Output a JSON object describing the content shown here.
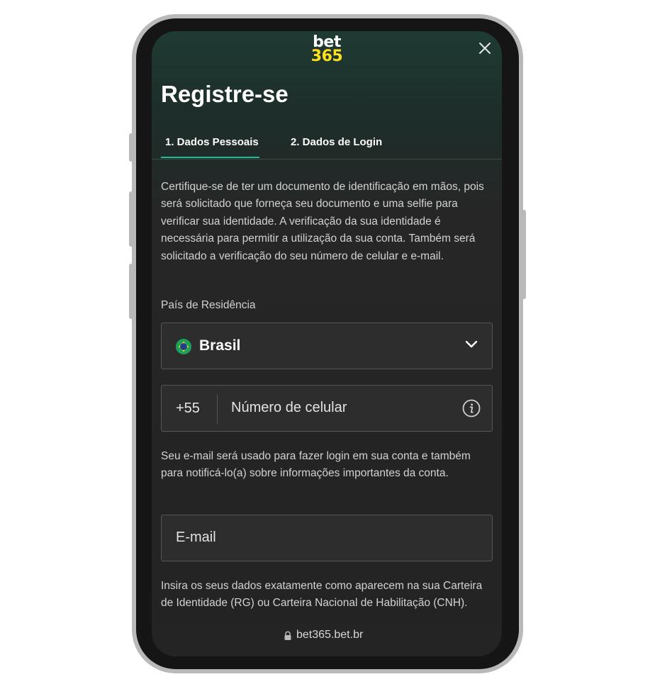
{
  "brand": {
    "logo_top": "bet",
    "logo_bottom": "365"
  },
  "page": {
    "title": "Registre-se"
  },
  "tabs": [
    {
      "label": "1. Dados Pessoais",
      "active": true
    },
    {
      "label": "2. Dados de Login",
      "active": false
    }
  ],
  "intro_text": "Certifique-se de ter um documento de identificação em mãos, pois será solicitado que forneça seu documento e uma selfie para verificar sua identidade. A verificação da sua identidade é necessária para permitir a utilização da sua conta. Também será solicitado a verificação do seu número de celular e e-mail.",
  "country": {
    "label": "País de Residência",
    "value": "Brasil",
    "flag_icon": "brazil-flag-icon"
  },
  "phone": {
    "country_code": "+55",
    "placeholder": "Número de celular"
  },
  "email_note": "Seu e-mail será usado para fazer login em sua conta e também para notificá-lo(a) sobre informações importantes da conta.",
  "email": {
    "placeholder": "E-mail"
  },
  "id_note": "Insira os seus dados exatamente como aparecem na sua Carteira de Identidade (RG) ou Carteira Nacional de Habilitação (CNH).",
  "browser": {
    "url": "bet365.bet.br"
  },
  "colors": {
    "accent": "#14c290",
    "brand_yellow": "#ffdf1b",
    "background": "#232323"
  }
}
